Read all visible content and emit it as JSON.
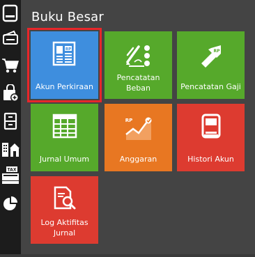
{
  "page": {
    "title": "Buku Besar"
  },
  "sidebar": {
    "items": [
      {
        "icon": "ledger-book-icon"
      },
      {
        "icon": "wallet-icon"
      },
      {
        "icon": "shopping-cart-icon"
      },
      {
        "icon": "shopping-bag-add-icon"
      },
      {
        "icon": "file-cabinet-icon"
      },
      {
        "icon": "buildings-icon"
      },
      {
        "icon": "tax-truck-icon"
      },
      {
        "icon": "pie-chart-icon"
      }
    ]
  },
  "tiles": [
    {
      "label": "Akun Perkiraan",
      "color": "#3e8ede",
      "icon": "account-document-icon",
      "selected": true
    },
    {
      "label": "Pencatatan Beban",
      "color": "#56a92b",
      "icon": "expense-record-icon",
      "selected": false
    },
    {
      "label": "Pencatatan Gaji",
      "color": "#56a92b",
      "icon": "salary-tag-icon",
      "selected": false
    },
    {
      "label": "Jurnal Umum",
      "color": "#56a92b",
      "icon": "journal-table-icon",
      "selected": false
    },
    {
      "label": "Anggaran",
      "color": "#e87722",
      "icon": "budget-chart-icon",
      "selected": false
    },
    {
      "label": "Histori Akun",
      "color": "#dd3b30",
      "icon": "account-history-icon",
      "selected": false
    },
    {
      "label": "Log Aktifitas Jurnal",
      "color": "#dd3b30",
      "icon": "journal-log-search-icon",
      "selected": false
    }
  ],
  "icon_text": {
    "rp": "RP"
  }
}
